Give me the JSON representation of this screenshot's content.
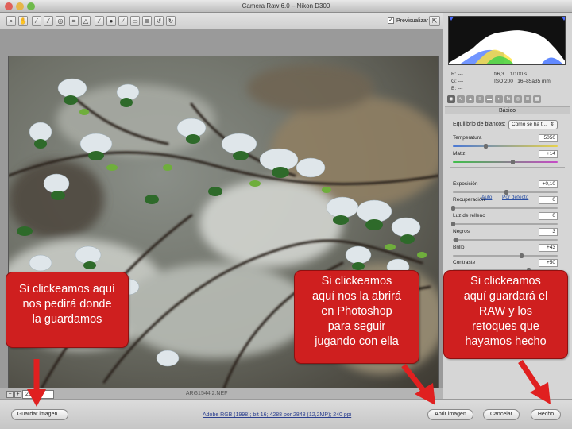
{
  "window": {
    "title": "Camera Raw 6.0 –  Nikon D300"
  },
  "toolbar": {
    "tools": [
      "zoom-icon",
      "hand-icon",
      "white-balance-icon",
      "color-sampler-icon",
      "target-adjust-icon",
      "crop-icon",
      "straighten-icon",
      "spot-removal-icon",
      "red-eye-icon",
      "adjustment-brush-icon",
      "graduated-filter-icon",
      "preferences-icon",
      "rotate-left-icon",
      "rotate-right-icon"
    ],
    "preview_label": "Previsualizar",
    "preview_checked": true
  },
  "histogram": {
    "rgb_labels": {
      "r": "R:",
      "g": "G:",
      "b": "B:"
    },
    "rgb_values": {
      "r": "---",
      "g": "---",
      "b": "---"
    },
    "aperture": "f/6,3",
    "shutter": "1/100 s",
    "iso": "ISO 200",
    "lens": "16–85a35 mm"
  },
  "panel": {
    "section_title": "Básico",
    "white_balance_label": "Equilibrio de blancos:",
    "white_balance_value": "Como se ha t...",
    "auto_link": "Auto",
    "default_link": "Por defecto",
    "sliders": [
      {
        "label": "Temperatura",
        "value": "5050",
        "pos": 0.31
      },
      {
        "label": "Matiz",
        "value": "+14",
        "pos": 0.57
      },
      {
        "label": "Exposición",
        "value": "+0,10",
        "pos": 0.51
      },
      {
        "label": "Recuperación",
        "value": "0",
        "pos": 0.0
      },
      {
        "label": "Luz de relleno",
        "value": "0",
        "pos": 0.0
      },
      {
        "label": "Negros",
        "value": "3",
        "pos": 0.03
      },
      {
        "label": "Brillo",
        "value": "+43",
        "pos": 0.65
      },
      {
        "label": "Contraste",
        "value": "+50",
        "pos": 0.72
      }
    ]
  },
  "statusbar": {
    "zoom_value": "23,2%",
    "filename": "_ARG1544 2.NEF"
  },
  "footer": {
    "save_label": "Guardar imagen...",
    "workflow_label": "Adobe RGB (1998); bit 16; 4288 por 2848 (12,2MP); 240 ppi",
    "open_label": "Abrir imagen",
    "cancel_label": "Cancelar",
    "done_label": "Hecho"
  },
  "callouts": {
    "save": [
      "Si clickeamos aquí",
      "nos pedirá donde",
      "la guardamos"
    ],
    "open": [
      "Si clickeamos",
      "aquí nos la abrirá",
      "en Photoshop",
      "para seguir",
      "jugando con ella"
    ],
    "done": [
      "Si clickeamos",
      "aquí guardará el",
      "RAW y los",
      "retoques que",
      "hayamos hecho"
    ]
  },
  "colors": {
    "callout": "#cf1f1f",
    "arrow": "#e02020"
  }
}
